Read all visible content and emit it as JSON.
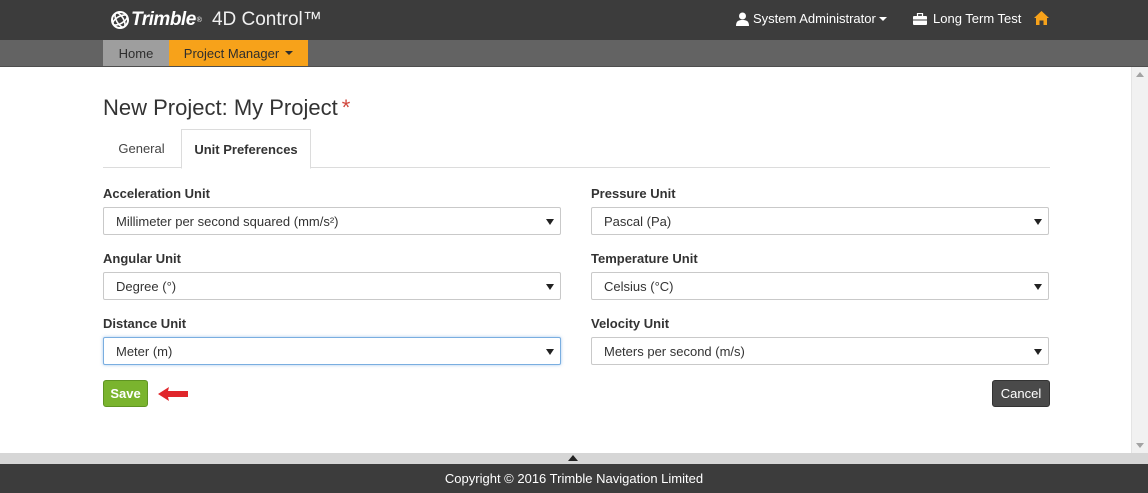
{
  "header": {
    "brand": "Trimble",
    "brand_reg": "®",
    "product": "4D Control™",
    "user": "System Administrator",
    "project": "Long Term Test",
    "accent_color": "#f7a21a"
  },
  "nav": {
    "home": "Home",
    "project_manager": "Project Manager"
  },
  "page": {
    "title": "New Project: My Project",
    "required_marker": "*"
  },
  "tabs": [
    {
      "label": "General",
      "active": false
    },
    {
      "label": "Unit Preferences",
      "active": true
    }
  ],
  "fields": {
    "acceleration": {
      "label": "Acceleration Unit",
      "value": "Millimeter per second squared (mm/s²)"
    },
    "pressure": {
      "label": "Pressure Unit",
      "value": "Pascal (Pa)"
    },
    "angular": {
      "label": "Angular Unit",
      "value": "Degree (°)"
    },
    "temperature": {
      "label": "Temperature Unit",
      "value": "Celsius (°C)"
    },
    "distance": {
      "label": "Distance Unit",
      "value": "Meter (m)"
    },
    "velocity": {
      "label": "Velocity Unit",
      "value": "Meters per second (m/s)"
    }
  },
  "buttons": {
    "save": "Save",
    "cancel": "Cancel"
  },
  "footer": {
    "copyright": "Copyright © 2016 Trimble Navigation Limited"
  }
}
